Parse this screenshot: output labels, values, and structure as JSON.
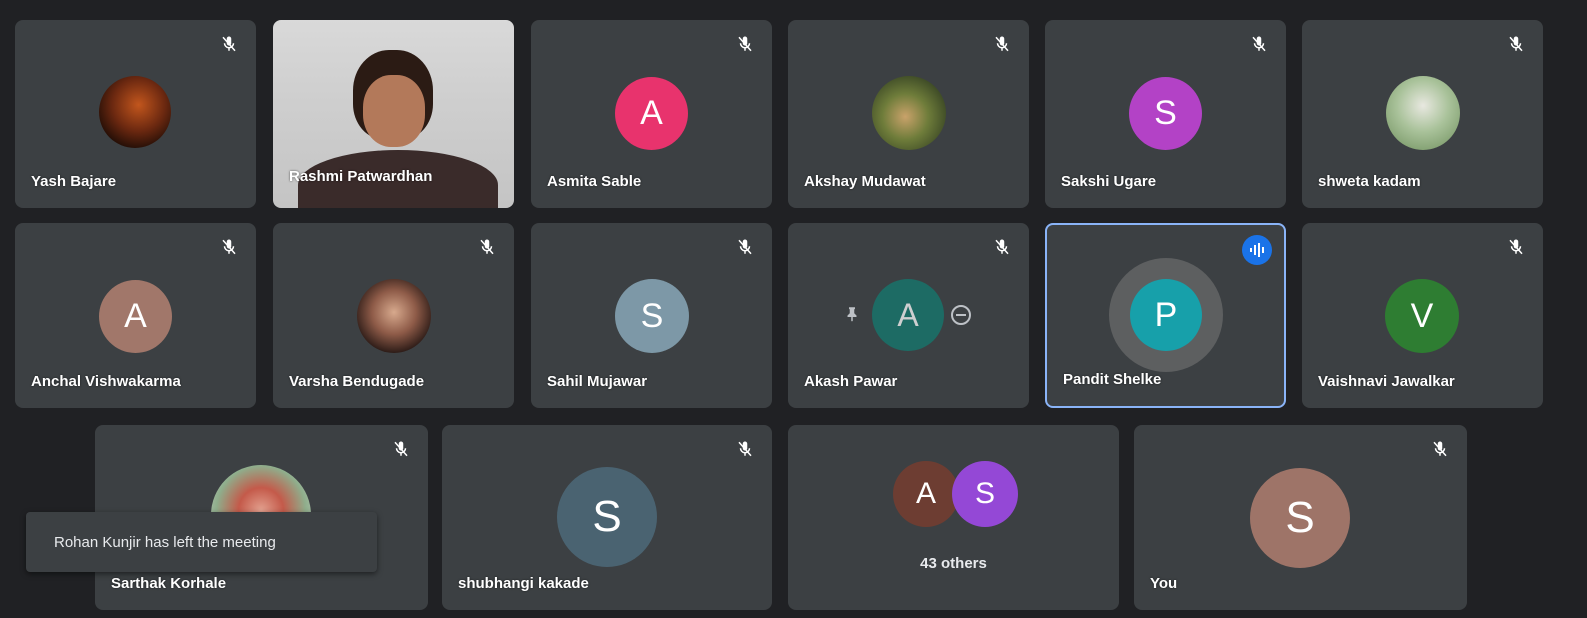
{
  "participants": {
    "yash": {
      "name": "Yash Bajare"
    },
    "rashmi": {
      "name": "Rashmi Patwardhan"
    },
    "asmita": {
      "name": "Asmita Sable",
      "initial": "A",
      "color": "#e8336d"
    },
    "akshay": {
      "name": "Akshay Mudawat"
    },
    "sakshi": {
      "name": "Sakshi Ugare",
      "initial": "S",
      "color": "#b342c6"
    },
    "shweta": {
      "name": "shweta kadam"
    },
    "anchal": {
      "name": "Anchal Vishwakarma",
      "initial": "A",
      "color": "#a1776a"
    },
    "varsha": {
      "name": "Varsha Bendugade"
    },
    "sahil": {
      "name": "Sahil Mujawar",
      "initial": "S",
      "color": "#7d98a7"
    },
    "akash": {
      "name": "Akash Pawar",
      "initial": "A",
      "color": "#137a6f"
    },
    "pandit": {
      "name": "Pandit Shelke",
      "initial": "P",
      "color": "#17a0aa"
    },
    "vaishnavi": {
      "name": "Vaishnavi Jawalkar",
      "initial": "V",
      "color": "#2e7d32"
    },
    "sarthak": {
      "name": "Sarthak Korhale"
    },
    "shubhangi": {
      "name": "shubhangi kakade",
      "initial": "S",
      "color": "#4a6371"
    },
    "you": {
      "name": "You",
      "initial": "S",
      "color": "#9e7468"
    }
  },
  "others": {
    "label": "43 others",
    "avatars": [
      {
        "initial": "A",
        "color": "#6d3d32"
      },
      {
        "initial": "S",
        "color": "#9448d6"
      }
    ]
  },
  "toast": {
    "message": "Rohan Kunjir has left the meeting"
  }
}
